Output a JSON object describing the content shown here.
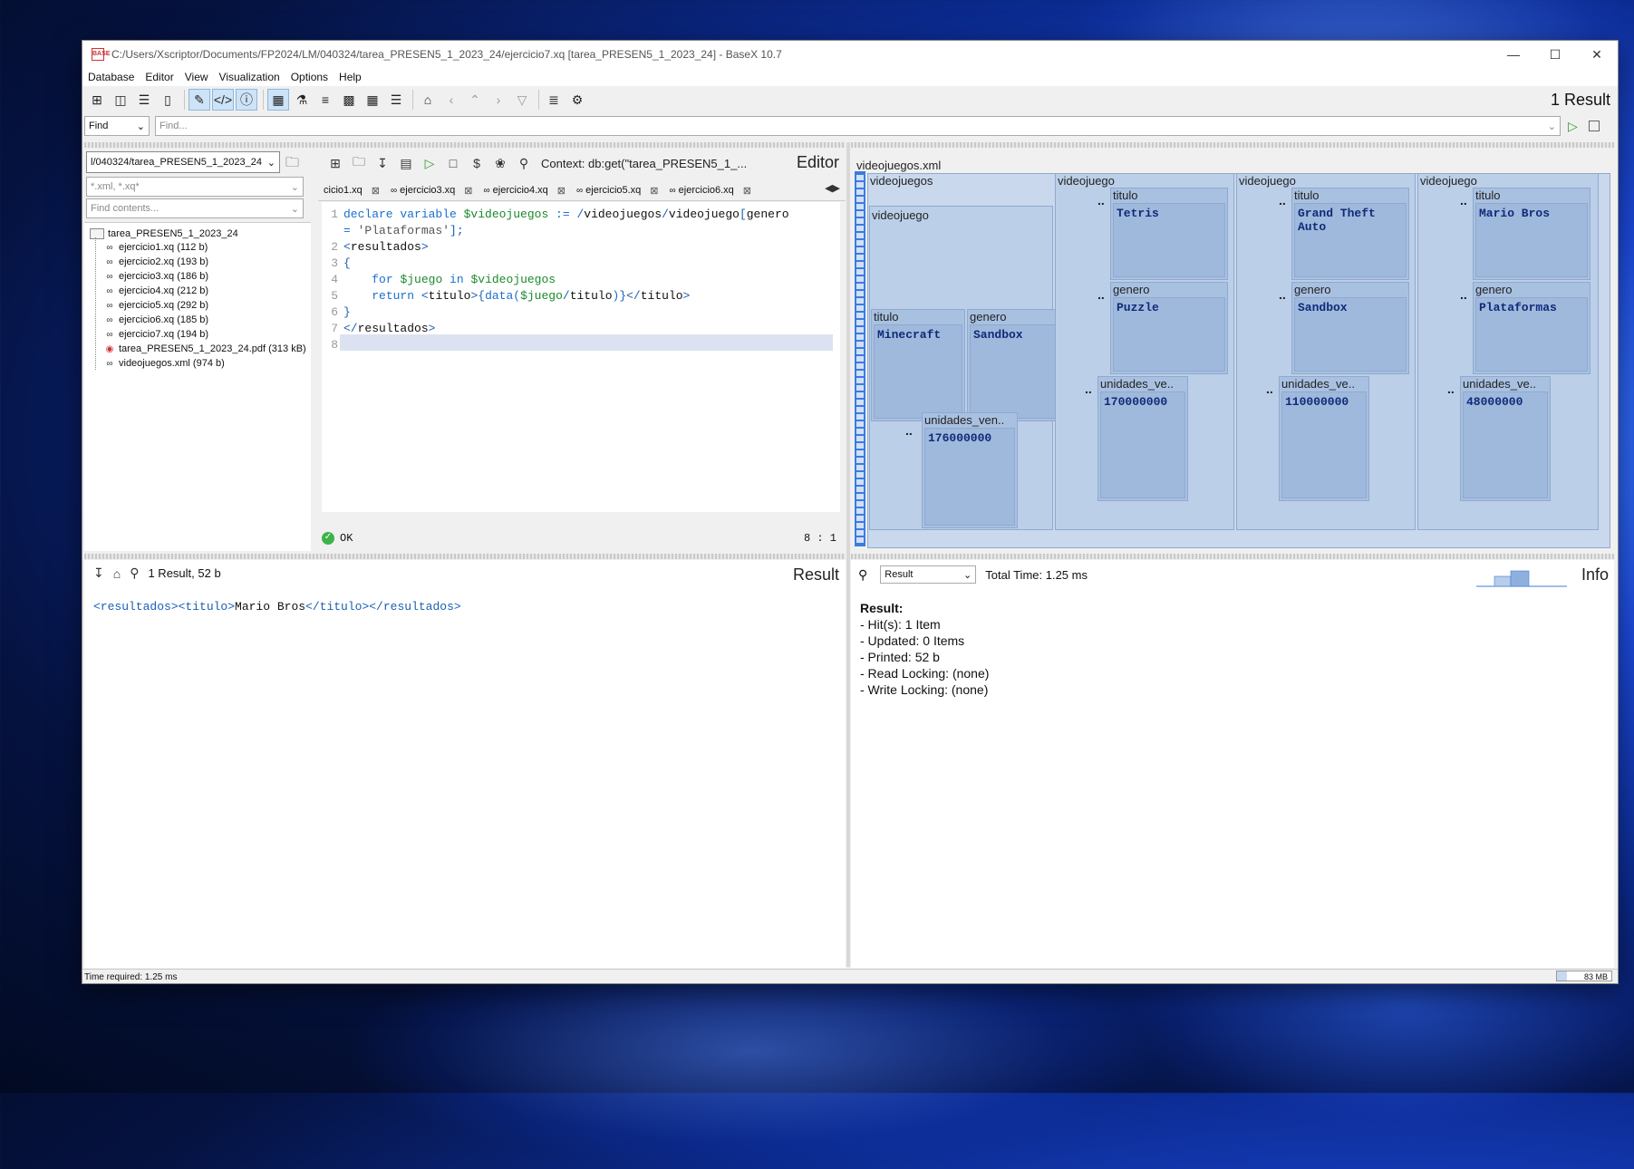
{
  "window": {
    "title": "C:/Users/Xscriptor/Documents/FP2024/LM/040324/tarea_PRESEN5_1_2023_24/ejercicio7.xq [tarea_PRESEN5_1_2023_24] - BaseX 10.7",
    "app_icon_text": "BASE"
  },
  "menu": [
    "Database",
    "Editor",
    "View",
    "Visualization",
    "Options",
    "Help"
  ],
  "toolbar": {
    "result_count": "1 Result"
  },
  "find": {
    "mode": "Find",
    "placeholder": "Find..."
  },
  "project": {
    "path": "l/040324/tarea_PRESEN5_1_2023_24",
    "filter_placeholder": "*.xml, *.xq*",
    "contents_placeholder": "Find contents...",
    "root": "tarea_PRESEN5_1_2023_24",
    "files": [
      {
        "name": "ejercicio1.xq (112 b)",
        "icon": "xquery-icon"
      },
      {
        "name": "ejercicio2.xq (193 b)",
        "icon": "xquery-icon"
      },
      {
        "name": "ejercicio3.xq (186 b)",
        "icon": "xquery-icon"
      },
      {
        "name": "ejercicio4.xq (212 b)",
        "icon": "xquery-icon"
      },
      {
        "name": "ejercicio5.xq (292 b)",
        "icon": "xquery-icon"
      },
      {
        "name": "ejercicio6.xq (185 b)",
        "icon": "xquery-icon"
      },
      {
        "name": "ejercicio7.xq (194 b)",
        "icon": "xquery-icon"
      },
      {
        "name": "tarea_PRESEN5_1_2023_24.pdf (313 kB)",
        "icon": "pdf-icon"
      },
      {
        "name": "videojuegos.xml (974 b)",
        "icon": "xml-icon"
      }
    ]
  },
  "editor": {
    "label": "Editor",
    "context": "Context: db:get(\"tarea_PRESEN5_1_...",
    "tabs": [
      "cicio1.xq",
      "ejercicio3.xq",
      "ejercicio4.xq",
      "ejercicio5.xq",
      "ejercicio6.xq"
    ],
    "line_numbers": [
      "1",
      "",
      "2",
      "3",
      "4",
      "5",
      "6",
      "7",
      "8"
    ],
    "status": "OK",
    "cursor": "8 : 1"
  },
  "map": {
    "file": "videojuegos.xml",
    "root": "videojuegos",
    "node_videojuego": "videojuego",
    "lbl_titulo": "titulo",
    "lbl_genero": "genero",
    "lbl_unidades": "unidades_ve..",
    "lbl_unidades_first": "unidades_ven..",
    "dots": "..",
    "games": [
      {
        "titulo": "Minecraft",
        "genero": "Sandbox",
        "unidades": "176000000"
      },
      {
        "titulo": "Tetris",
        "genero": "Puzzle",
        "unidades": "170000000"
      },
      {
        "titulo": "Grand Theft\nAuto",
        "genero": "Sandbox",
        "unidades": "110000000"
      },
      {
        "titulo": "Mario Bros",
        "genero": "Plataformas",
        "unidades": "48000000"
      }
    ]
  },
  "result": {
    "label": "Result",
    "summary": "1 Result, 52 b",
    "open_tag": "<resultados><titulo>",
    "value": "Mario Bros",
    "close_tag": "</titulo></resultados>"
  },
  "info": {
    "label": "Info",
    "select": "Result",
    "total_time": "Total Time: 1.25 ms",
    "heading": "Result:",
    "lines": [
      "- Hit(s): 1 Item",
      "- Updated: 0 Items",
      "- Printed: 52 b",
      "- Read Locking: (none)",
      "- Write Locking: (none)"
    ]
  },
  "status": {
    "time_required": "Time required: 1.25 ms",
    "memory": "83 MB"
  },
  "colors": {
    "accent": "#3d7be0",
    "map_cell": "#b7cbe6",
    "map_leaf": "#9fb9dd",
    "code_keyword": "#1a6fcf",
    "code_variable": "#1b8a2c"
  }
}
